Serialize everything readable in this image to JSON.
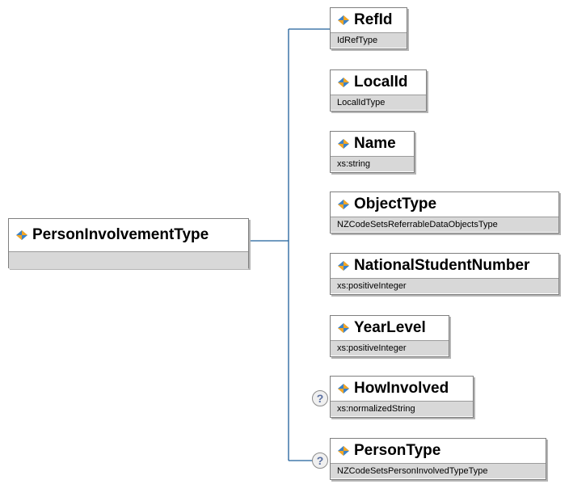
{
  "root": {
    "name": "PersonInvolvementType",
    "icon": "element-icon"
  },
  "children": [
    {
      "name": "RefId",
      "type": "IdRefType",
      "optional": false,
      "icon": "element-icon"
    },
    {
      "name": "LocalId",
      "type": "LocalIdType",
      "optional": false,
      "icon": "element-icon"
    },
    {
      "name": "Name",
      "type": "xs:string",
      "optional": false,
      "icon": "element-icon"
    },
    {
      "name": "ObjectType",
      "type": "NZCodeSetsReferrableDataObjectsType",
      "optional": false,
      "icon": "element-icon"
    },
    {
      "name": "NationalStudentNumber",
      "type": "xs:positiveInteger",
      "optional": false,
      "icon": "element-icon"
    },
    {
      "name": "YearLevel",
      "type": "xs:positiveInteger",
      "optional": false,
      "icon": "element-icon"
    },
    {
      "name": "HowInvolved",
      "type": "xs:normalizedString",
      "optional": true,
      "optional_marker": "?",
      "icon": "element-icon"
    },
    {
      "name": "PersonType",
      "type": "NZCodeSetsPersonInvolvedTypeType",
      "optional": true,
      "optional_marker": "?",
      "icon": "element-icon"
    }
  ],
  "colors": {
    "connector": "#1f5f9a",
    "icon_orange": "#f5a623",
    "icon_blue": "#3b82c8",
    "type_bar": "#d8d8d8"
  }
}
